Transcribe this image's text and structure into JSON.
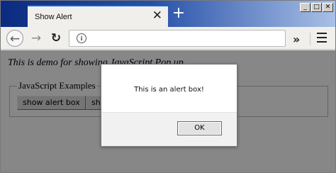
{
  "tab": {
    "title": "Show Alert",
    "close_glyph": "✕"
  },
  "new_tab_glyph": "+",
  "window_controls": {
    "minimize": "_",
    "maximize": "□",
    "close": "✕"
  },
  "toolbar": {
    "back_glyph": "←",
    "forward_glyph": "→",
    "reload_glyph": "↻",
    "info_glyph": "i",
    "overflow_glyph": "»"
  },
  "page": {
    "heading": "This is demo for showing JavaScript Pop up",
    "legend": "JavaScript Examples",
    "buttons": [
      "show alert box",
      "show confirm box"
    ]
  },
  "dialog": {
    "message": "This is an alert box!",
    "ok_label": "OK"
  },
  "icons": [
    "close-icon",
    "plus-icon",
    "back-arrow-icon",
    "forward-arrow-icon",
    "reload-icon",
    "info-icon",
    "overflow-chevron-icon",
    "hamburger-menu-icon"
  ]
}
